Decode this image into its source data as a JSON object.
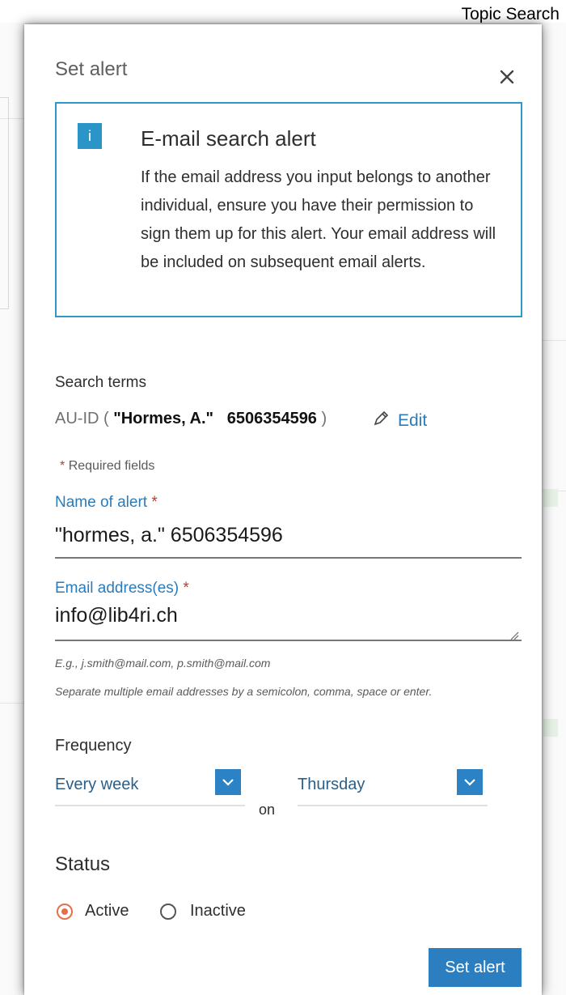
{
  "corner_label": "Topic Search",
  "dialog": {
    "title": "Set alert",
    "info": {
      "badge": "i",
      "title": "E-mail search alert",
      "text": "If the email address you input belongs to another individual, ensure you have their permission to sign them up for this alert. Your email address will be included on subsequent email alerts."
    },
    "search_terms": {
      "label": "Search terms",
      "prefix": "AU-ID ( ",
      "name": "\"Hormes, A.\"",
      "id": "6506354596",
      "suffix": " )",
      "edit_label": "Edit"
    },
    "required_note": "Required fields",
    "name_of_alert": {
      "label": "Name of alert",
      "value": "\"hormes, a.\" 6506354596"
    },
    "email": {
      "label": "Email address(es)",
      "value": "info@lib4ri.ch",
      "hint_example": "E.g., j.smith@mail.com, p.smith@mail.com",
      "hint_separator": "Separate multiple email addresses by a semicolon, comma, space or enter."
    },
    "frequency": {
      "label": "Frequency",
      "interval": "Every week",
      "on_text": "on",
      "day": "Thursday"
    },
    "status": {
      "label": "Status",
      "options": [
        "Active",
        "Inactive"
      ],
      "selected": "Active"
    },
    "submit_label": "Set alert"
  },
  "colors": {
    "accent": "#2b7fc0",
    "info_border": "#2d98c9",
    "radio_selected": "#e4704b",
    "required": "#c0392b"
  },
  "icons": {
    "close": "close-icon",
    "edit": "pencil-icon",
    "info": "info-icon",
    "dropdown": "chevron-down-icon"
  }
}
